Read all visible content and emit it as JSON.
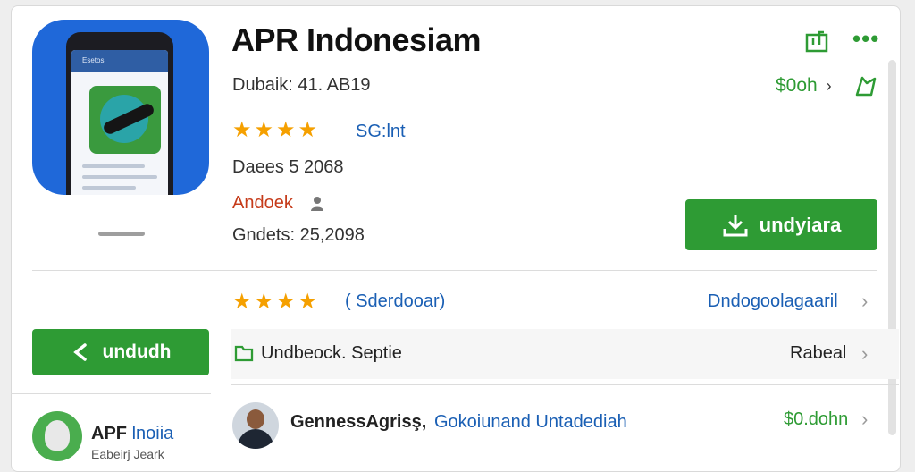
{
  "app": {
    "title": "APR Indonesiam",
    "dubaike": "Dubaik: 41. AB19",
    "rating_link": "SG:lnt",
    "daees": "Daees 5 2068",
    "developer": "Andoek",
    "gndets": "Gndets: 25,2098",
    "price": "$0oh",
    "install_label": "undyiara",
    "icon_screen_text": "Esetos"
  },
  "header_actions": {
    "price_chevron": "›"
  },
  "reviews_row": {
    "stars": "★★★★",
    "label": "( Sderdooar)",
    "link": "Dndogoolagaaril"
  },
  "side_button": {
    "label": "undudh"
  },
  "update_row": {
    "label": "Undbeock. Septie",
    "right": "Rabeal"
  },
  "related": {
    "app_name_bold": "APF",
    "app_name_blue": "lnoiia",
    "app_sub": "Eabeirj Jeark",
    "developer": "GennessAgrisş,",
    "subtitle": "Gokoiunand Untadediah",
    "price": "$0.dohn"
  },
  "rating_stars": "★★★★",
  "colors": {
    "green": "#2e9b34",
    "blue": "#1a5fb4",
    "star": "#f5a000",
    "developer_red": "#c63b1a"
  },
  "icons": [
    "external-link-icon",
    "more-icon",
    "wishlist-icon",
    "download-icon",
    "share-icon",
    "folder-icon",
    "person-icon",
    "chevron-right-icon"
  ]
}
